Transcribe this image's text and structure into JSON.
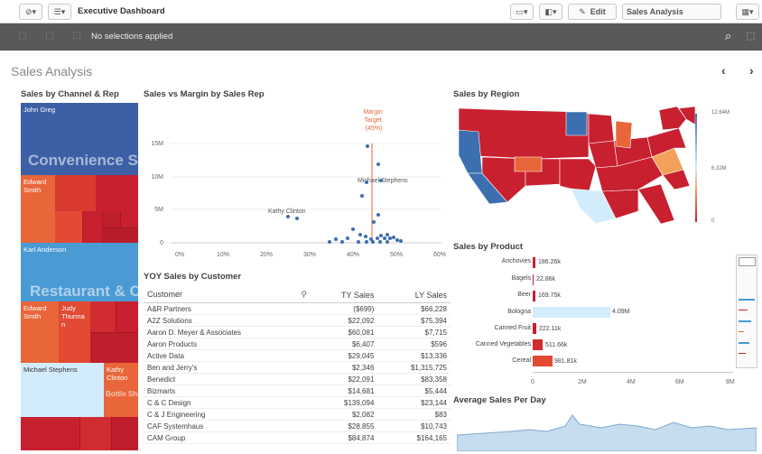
{
  "toolbar": {
    "app_title": "Executive Dashboard",
    "edit_label": "Edit",
    "sheet_name": "Sales Analysis"
  },
  "selections": {
    "text": "No selections applied"
  },
  "sheet": {
    "title": "Sales Analysis"
  },
  "treemap": {
    "title": "Sales by Channel & Rep",
    "channel1": "Convenience Stores",
    "channel2": "Restaurant & Cafes",
    "reps": [
      "John Greg",
      "Edward Smith",
      "Karl Anderson",
      "Edward Smith",
      "Judy Thurma n",
      "Michael Stephens",
      "Kathy Clinton",
      "Bottle Shops"
    ],
    "colors": {
      "blue_dark": "#3c5fa5",
      "blue": "#4a9ad4",
      "red": "#c8202f",
      "orange": "#e8663a",
      "light_blue": "#d3ecfb"
    }
  },
  "scatter": {
    "title": "Sales vs Margin by Sales Rep",
    "target_label": "Margin Target (45%)",
    "annotation1": "Michael Stephens",
    "annotation2": "Kathy Clinton",
    "y_ticks": [
      "15M",
      "10M",
      "5M",
      "0"
    ],
    "x_ticks": [
      "0%",
      "10%",
      "20%",
      "30%",
      "40%",
      "50%",
      "60%"
    ]
  },
  "region": {
    "title": "Sales by Region",
    "legend_max": "12.64M",
    "legend_mid": "6.32M",
    "legend_min": "0"
  },
  "product": {
    "title": "Sales by Product",
    "items": [
      {
        "name": "Anchovies",
        "value": "186.26k"
      },
      {
        "name": "Bagels",
        "value": "22.86k"
      },
      {
        "name": "Beer",
        "value": "169.75k"
      },
      {
        "name": "Bologna",
        "value": "4.09M"
      },
      {
        "name": "Canned Fruit",
        "value": "222.11k"
      },
      {
        "name": "Canned Vegetables",
        "value": "511.66k"
      },
      {
        "name": "Cereal",
        "value": "981.81k"
      }
    ],
    "x_ticks": [
      "0",
      "2M",
      "4M",
      "6M",
      "8M"
    ]
  },
  "yoy": {
    "title": "YOY Sales by Customer",
    "headers": {
      "customer": "Customer",
      "ty": "TY Sales",
      "ly": "LY Sales"
    },
    "rows": [
      [
        "A&R Partners",
        "($699)",
        "$66,228"
      ],
      [
        "A2Z Solutions",
        "$22,092",
        "$75,394"
      ],
      [
        "Aaron D. Meyer & Associates",
        "$60,081",
        "$7,715"
      ],
      [
        "Aaron Products",
        "$6,407",
        "$596"
      ],
      [
        "Active Data",
        "$29,045",
        "$13,336"
      ],
      [
        "Ben and Jerry's",
        "$2,346",
        "$1,315,725"
      ],
      [
        "Benedict",
        "$22,091",
        "$83,358"
      ],
      [
        "Bizmarts",
        "$14,681",
        "$5,444"
      ],
      [
        "C & C Design",
        "$139,094",
        "$23,144"
      ],
      [
        "C & J Engineering",
        "$2,082",
        "$83"
      ],
      [
        "CAF Systemhaus",
        "$28,855",
        "$10,743"
      ],
      [
        "CAM Group",
        "$84,874",
        "$164,165"
      ]
    ]
  },
  "avg": {
    "title": "Average Sales Per Day"
  }
}
